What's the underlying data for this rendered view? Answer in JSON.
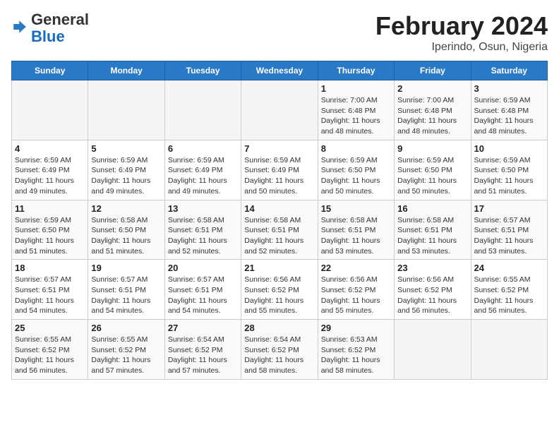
{
  "header": {
    "logo_general": "General",
    "logo_blue": "Blue",
    "month_year": "February 2024",
    "location": "Iperindo, Osun, Nigeria"
  },
  "weekdays": [
    "Sunday",
    "Monday",
    "Tuesday",
    "Wednesday",
    "Thursday",
    "Friday",
    "Saturday"
  ],
  "weeks": [
    [
      {
        "day": "",
        "info": ""
      },
      {
        "day": "",
        "info": ""
      },
      {
        "day": "",
        "info": ""
      },
      {
        "day": "",
        "info": ""
      },
      {
        "day": "1",
        "info": "Sunrise: 7:00 AM\nSunset: 6:48 PM\nDaylight: 11 hours\nand 48 minutes."
      },
      {
        "day": "2",
        "info": "Sunrise: 7:00 AM\nSunset: 6:48 PM\nDaylight: 11 hours\nand 48 minutes."
      },
      {
        "day": "3",
        "info": "Sunrise: 6:59 AM\nSunset: 6:48 PM\nDaylight: 11 hours\nand 48 minutes."
      }
    ],
    [
      {
        "day": "4",
        "info": "Sunrise: 6:59 AM\nSunset: 6:49 PM\nDaylight: 11 hours\nand 49 minutes."
      },
      {
        "day": "5",
        "info": "Sunrise: 6:59 AM\nSunset: 6:49 PM\nDaylight: 11 hours\nand 49 minutes."
      },
      {
        "day": "6",
        "info": "Sunrise: 6:59 AM\nSunset: 6:49 PM\nDaylight: 11 hours\nand 49 minutes."
      },
      {
        "day": "7",
        "info": "Sunrise: 6:59 AM\nSunset: 6:49 PM\nDaylight: 11 hours\nand 50 minutes."
      },
      {
        "day": "8",
        "info": "Sunrise: 6:59 AM\nSunset: 6:50 PM\nDaylight: 11 hours\nand 50 minutes."
      },
      {
        "day": "9",
        "info": "Sunrise: 6:59 AM\nSunset: 6:50 PM\nDaylight: 11 hours\nand 50 minutes."
      },
      {
        "day": "10",
        "info": "Sunrise: 6:59 AM\nSunset: 6:50 PM\nDaylight: 11 hours\nand 51 minutes."
      }
    ],
    [
      {
        "day": "11",
        "info": "Sunrise: 6:59 AM\nSunset: 6:50 PM\nDaylight: 11 hours\nand 51 minutes."
      },
      {
        "day": "12",
        "info": "Sunrise: 6:58 AM\nSunset: 6:50 PM\nDaylight: 11 hours\nand 51 minutes."
      },
      {
        "day": "13",
        "info": "Sunrise: 6:58 AM\nSunset: 6:51 PM\nDaylight: 11 hours\nand 52 minutes."
      },
      {
        "day": "14",
        "info": "Sunrise: 6:58 AM\nSunset: 6:51 PM\nDaylight: 11 hours\nand 52 minutes."
      },
      {
        "day": "15",
        "info": "Sunrise: 6:58 AM\nSunset: 6:51 PM\nDaylight: 11 hours\nand 53 minutes."
      },
      {
        "day": "16",
        "info": "Sunrise: 6:58 AM\nSunset: 6:51 PM\nDaylight: 11 hours\nand 53 minutes."
      },
      {
        "day": "17",
        "info": "Sunrise: 6:57 AM\nSunset: 6:51 PM\nDaylight: 11 hours\nand 53 minutes."
      }
    ],
    [
      {
        "day": "18",
        "info": "Sunrise: 6:57 AM\nSunset: 6:51 PM\nDaylight: 11 hours\nand 54 minutes."
      },
      {
        "day": "19",
        "info": "Sunrise: 6:57 AM\nSunset: 6:51 PM\nDaylight: 11 hours\nand 54 minutes."
      },
      {
        "day": "20",
        "info": "Sunrise: 6:57 AM\nSunset: 6:51 PM\nDaylight: 11 hours\nand 54 minutes."
      },
      {
        "day": "21",
        "info": "Sunrise: 6:56 AM\nSunset: 6:52 PM\nDaylight: 11 hours\nand 55 minutes."
      },
      {
        "day": "22",
        "info": "Sunrise: 6:56 AM\nSunset: 6:52 PM\nDaylight: 11 hours\nand 55 minutes."
      },
      {
        "day": "23",
        "info": "Sunrise: 6:56 AM\nSunset: 6:52 PM\nDaylight: 11 hours\nand 56 minutes."
      },
      {
        "day": "24",
        "info": "Sunrise: 6:55 AM\nSunset: 6:52 PM\nDaylight: 11 hours\nand 56 minutes."
      }
    ],
    [
      {
        "day": "25",
        "info": "Sunrise: 6:55 AM\nSunset: 6:52 PM\nDaylight: 11 hours\nand 56 minutes."
      },
      {
        "day": "26",
        "info": "Sunrise: 6:55 AM\nSunset: 6:52 PM\nDaylight: 11 hours\nand 57 minutes."
      },
      {
        "day": "27",
        "info": "Sunrise: 6:54 AM\nSunset: 6:52 PM\nDaylight: 11 hours\nand 57 minutes."
      },
      {
        "day": "28",
        "info": "Sunrise: 6:54 AM\nSunset: 6:52 PM\nDaylight: 11 hours\nand 58 minutes."
      },
      {
        "day": "29",
        "info": "Sunrise: 6:53 AM\nSunset: 6:52 PM\nDaylight: 11 hours\nand 58 minutes."
      },
      {
        "day": "",
        "info": ""
      },
      {
        "day": "",
        "info": ""
      }
    ]
  ]
}
